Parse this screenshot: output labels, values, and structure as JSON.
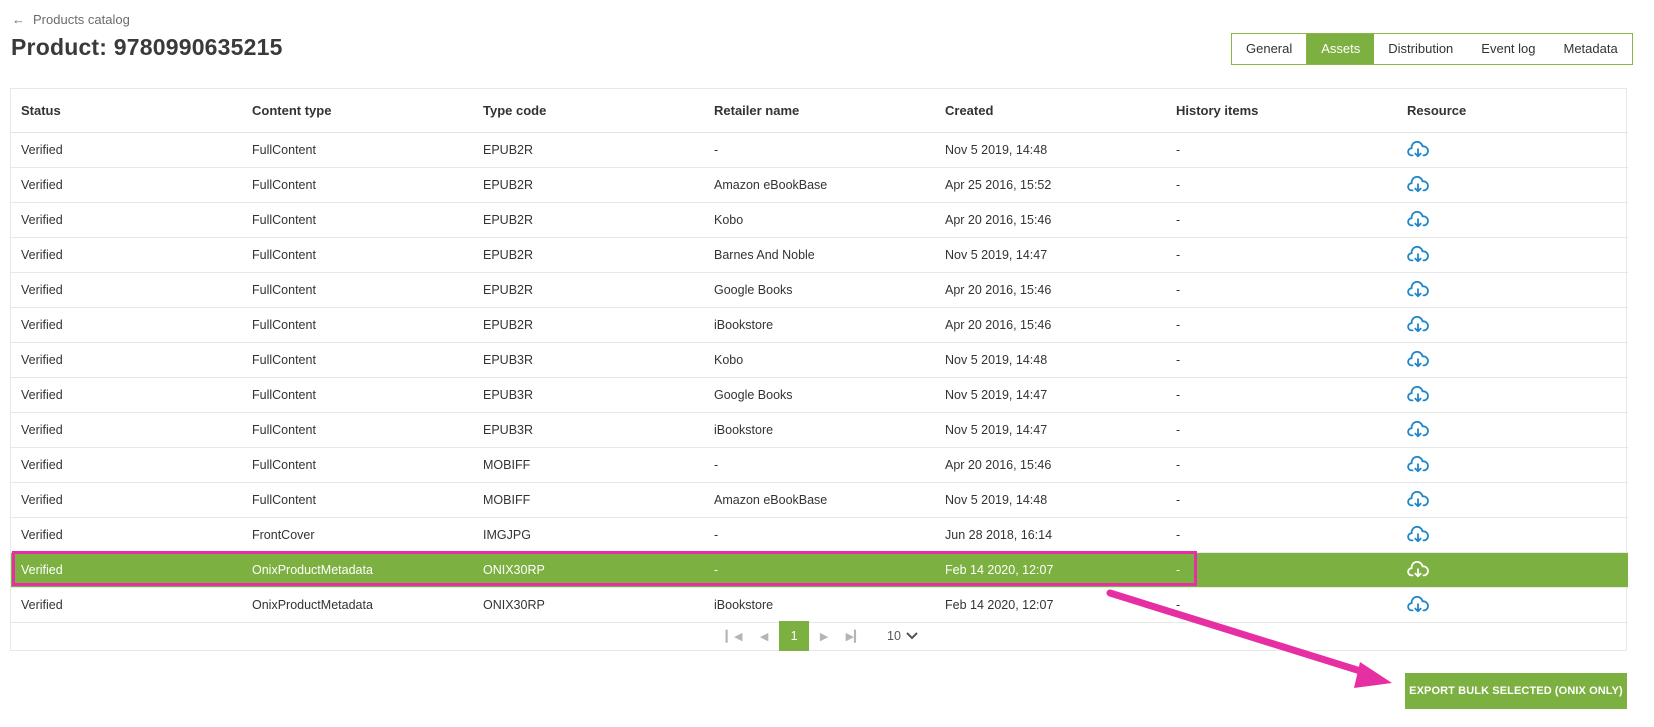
{
  "header": {
    "back_label": "Products catalog",
    "title": "Product: 9780990635215"
  },
  "tabs": [
    {
      "label": "General",
      "active": false
    },
    {
      "label": "Assets",
      "active": true
    },
    {
      "label": "Distribution",
      "active": false
    },
    {
      "label": "Event log",
      "active": false
    },
    {
      "label": "Metadata",
      "active": false
    }
  ],
  "table": {
    "columns": [
      "Status",
      "Content type",
      "Type code",
      "Retailer name",
      "Created",
      "History items",
      "Resource"
    ],
    "rows": [
      {
        "status": "Verified",
        "content_type": "FullContent",
        "type_code": "EPUB2R",
        "retailer": "-",
        "created": "Nov 5 2019, 14:48",
        "history": "-",
        "resource_icon": "cloud-download-icon",
        "selected": false
      },
      {
        "status": "Verified",
        "content_type": "FullContent",
        "type_code": "EPUB2R",
        "retailer": "Amazon eBookBase",
        "created": "Apr 25 2016, 15:52",
        "history": "-",
        "resource_icon": "cloud-download-icon",
        "selected": false
      },
      {
        "status": "Verified",
        "content_type": "FullContent",
        "type_code": "EPUB2R",
        "retailer": "Kobo",
        "created": "Apr 20 2016, 15:46",
        "history": "-",
        "resource_icon": "cloud-download-icon",
        "selected": false
      },
      {
        "status": "Verified",
        "content_type": "FullContent",
        "type_code": "EPUB2R",
        "retailer": "Barnes And Noble",
        "created": "Nov 5 2019, 14:47",
        "history": "-",
        "resource_icon": "cloud-download-icon",
        "selected": false
      },
      {
        "status": "Verified",
        "content_type": "FullContent",
        "type_code": "EPUB2R",
        "retailer": "Google Books",
        "created": "Apr 20 2016, 15:46",
        "history": "-",
        "resource_icon": "cloud-download-icon",
        "selected": false
      },
      {
        "status": "Verified",
        "content_type": "FullContent",
        "type_code": "EPUB2R",
        "retailer": "iBookstore",
        "created": "Apr 20 2016, 15:46",
        "history": "-",
        "resource_icon": "cloud-download-icon",
        "selected": false
      },
      {
        "status": "Verified",
        "content_type": "FullContent",
        "type_code": "EPUB3R",
        "retailer": "Kobo",
        "created": "Nov 5 2019, 14:48",
        "history": "-",
        "resource_icon": "cloud-download-icon",
        "selected": false
      },
      {
        "status": "Verified",
        "content_type": "FullContent",
        "type_code": "EPUB3R",
        "retailer": "Google Books",
        "created": "Nov 5 2019, 14:47",
        "history": "-",
        "resource_icon": "cloud-download-icon",
        "selected": false
      },
      {
        "status": "Verified",
        "content_type": "FullContent",
        "type_code": "EPUB3R",
        "retailer": "iBookstore",
        "created": "Nov 5 2019, 14:47",
        "history": "-",
        "resource_icon": "cloud-download-icon",
        "selected": false
      },
      {
        "status": "Verified",
        "content_type": "FullContent",
        "type_code": "MOBIFF",
        "retailer": "-",
        "created": "Apr 20 2016, 15:46",
        "history": "-",
        "resource_icon": "cloud-download-icon",
        "selected": false
      },
      {
        "status": "Verified",
        "content_type": "FullContent",
        "type_code": "MOBIFF",
        "retailer": "Amazon eBookBase",
        "created": "Nov 5 2019, 14:48",
        "history": "-",
        "resource_icon": "cloud-download-icon",
        "selected": false
      },
      {
        "status": "Verified",
        "content_type": "FrontCover",
        "type_code": "IMGJPG",
        "retailer": "-",
        "created": "Jun 28 2018, 16:14",
        "history": "-",
        "resource_icon": "cloud-download-icon",
        "selected": false
      },
      {
        "status": "Verified",
        "content_type": "OnixProductMetadata",
        "type_code": "ONIX30RP",
        "retailer": "-",
        "created": "Feb 14 2020, 12:07",
        "history": "-",
        "resource_icon": "cloud-download-icon",
        "selected": true
      },
      {
        "status": "Verified",
        "content_type": "OnixProductMetadata",
        "type_code": "ONIX30RP",
        "retailer": "iBookstore",
        "created": "Feb 14 2020, 12:07",
        "history": "-",
        "resource_icon": "cloud-download-icon",
        "selected": false
      }
    ]
  },
  "pagination": {
    "current_page": "1",
    "page_size": "10",
    "first_icon": "first-page-icon",
    "prev_icon": "prev-page-icon",
    "next_icon": "next-page-icon",
    "last_icon": "last-page-icon"
  },
  "export_button": {
    "label": "EXPORT BULK SELECTED (ONIX ONLY)"
  },
  "colors": {
    "accent": "#7cb040",
    "annotation": "#e62fa3",
    "icon_blue": "#1f86c8"
  }
}
